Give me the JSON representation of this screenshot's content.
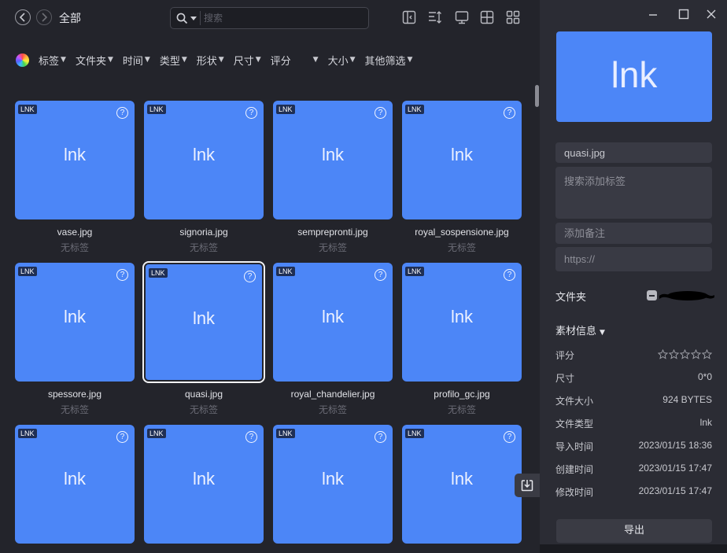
{
  "toolbar": {
    "breadcrumb": "全部",
    "search_placeholder": "搜索"
  },
  "filters": [
    {
      "label": "标签"
    },
    {
      "label": "文件夹"
    },
    {
      "label": "时间"
    },
    {
      "label": "类型"
    },
    {
      "label": "形状"
    },
    {
      "label": "尺寸"
    },
    {
      "label": "评分"
    },
    {
      "label": ""
    },
    {
      "label": "大小"
    },
    {
      "label": "其他筛选"
    }
  ],
  "grid": {
    "items": [
      {
        "badge": "LNK",
        "thumb_text": "lnk",
        "name": "vase.jpg",
        "tag": "无标签"
      },
      {
        "badge": "LNK",
        "thumb_text": "lnk",
        "name": "signoria.jpg",
        "tag": "无标签"
      },
      {
        "badge": "LNK",
        "thumb_text": "lnk",
        "name": "sempreprontі.jpg",
        "tag": "无标签"
      },
      {
        "badge": "LNK",
        "thumb_text": "lnk",
        "name": "royal_sospensione.jpg",
        "tag": "无标签"
      },
      {
        "badge": "LNK",
        "thumb_text": "lnk",
        "name": "spessore.jpg",
        "tag": "无标签"
      },
      {
        "badge": "LNK",
        "thumb_text": "lnk",
        "name": "quasi.jpg",
        "tag": "无标签",
        "selected": true
      },
      {
        "badge": "LNK",
        "thumb_text": "lnk",
        "name": "royal_chandelier.jpg",
        "tag": "无标签"
      },
      {
        "badge": "LNK",
        "thumb_text": "lnk",
        "name": "profilo_gc.jpg",
        "tag": "无标签"
      },
      {
        "badge": "LNK",
        "thumb_text": "lnk",
        "name": "",
        "tag": ""
      },
      {
        "badge": "LNK",
        "thumb_text": "lnk",
        "name": "",
        "tag": ""
      },
      {
        "badge": "LNK",
        "thumb_text": "lnk",
        "name": "",
        "tag": ""
      },
      {
        "badge": "LNK",
        "thumb_text": "lnk",
        "name": "",
        "tag": ""
      }
    ]
  },
  "sidebar": {
    "preview_text": "lnk",
    "name_value": "quasi.jpg",
    "tags_placeholder": "搜索添加标签",
    "note_placeholder": "添加备注",
    "url_placeholder": "https://",
    "folder_label": "文件夹",
    "info_heading": "素材信息",
    "rating_label": "评分",
    "rating_value": 0,
    "info": [
      {
        "key": "尺寸",
        "value": "0*0"
      },
      {
        "key": "文件大小",
        "value": "924 BYTES"
      },
      {
        "key": "文件类型",
        "value": "lnk"
      },
      {
        "key": "导入时间",
        "value": "2023/01/15 18:36"
      },
      {
        "key": "创建时间",
        "value": "2023/01/15 17:47"
      },
      {
        "key": "修改时间",
        "value": "2023/01/15 17:47"
      }
    ],
    "export_label": "导出"
  },
  "colors": {
    "thumb": "#4c86f7",
    "background": "#23242b",
    "sidebar": "#2b2c34"
  }
}
